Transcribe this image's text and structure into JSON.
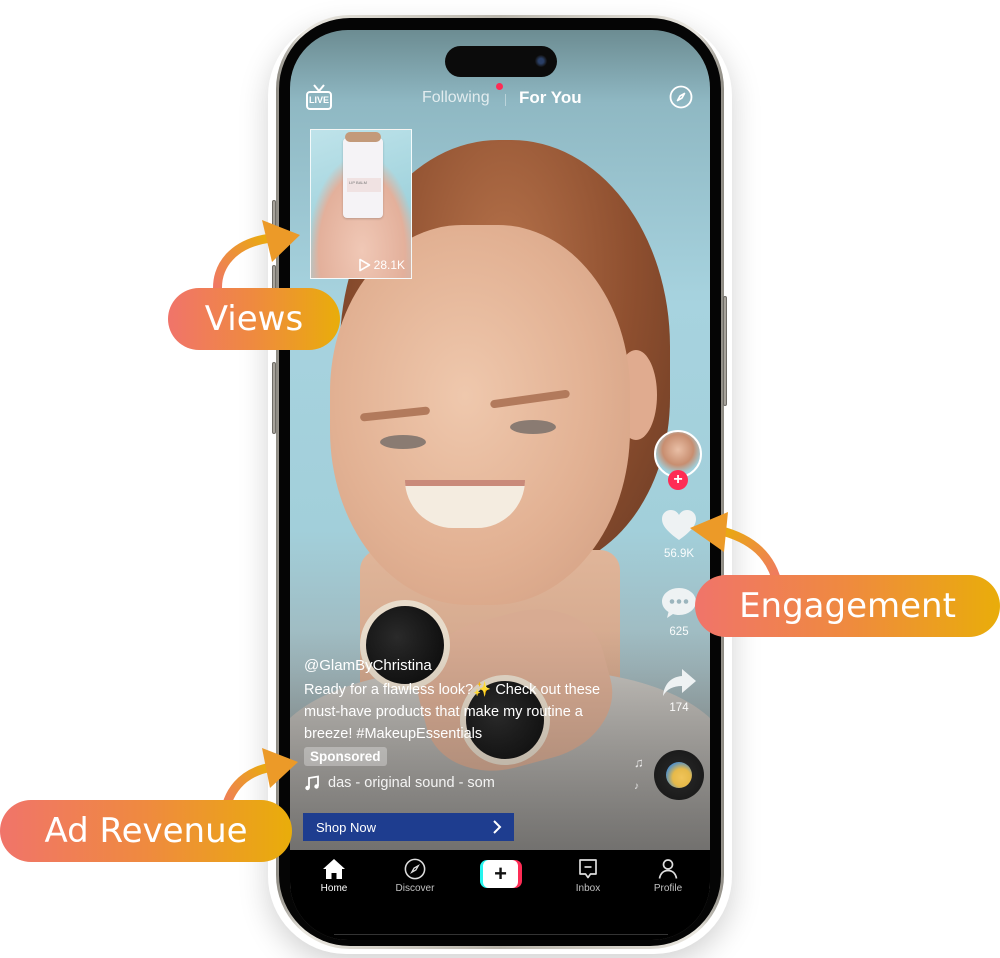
{
  "top_bar": {
    "live_label": "LIVE",
    "tabs": [
      {
        "label": "Following",
        "active": false,
        "has_notification_dot": true
      },
      {
        "label": "For You",
        "active": true
      }
    ],
    "right_icon": "compass-icon"
  },
  "thumbnail": {
    "product_label": "LIP BALM",
    "views": "28.1K",
    "views_icon": "play-icon"
  },
  "right_rail": {
    "avatar_icon": "creator-avatar",
    "follow_label": "+",
    "likes": "56.9K",
    "comments": "625",
    "shares": "174"
  },
  "caption": {
    "username": "@GlamByChristina",
    "description": "Ready for a flawless look?✨ Check out these must-have products that make my routine a breeze! #MakeupEssentials",
    "sponsored_label": "Sponsored",
    "sound": "das - original sound - som"
  },
  "cta": {
    "label": "Shop Now",
    "chevron": "›",
    "color": "#1e3d8f"
  },
  "bottom_nav": {
    "items": [
      {
        "label": "Home",
        "icon": "home-icon",
        "active": true
      },
      {
        "label": "Discover",
        "icon": "compass-icon",
        "active": false
      },
      {
        "label": "",
        "icon": "create-plus-icon",
        "active": false
      },
      {
        "label": "Inbox",
        "icon": "inbox-icon",
        "active": false
      },
      {
        "label": "Profile",
        "icon": "profile-icon",
        "active": false
      }
    ],
    "create_label": "+"
  },
  "annotations": [
    {
      "label": "Views",
      "target": "thumbnail-views"
    },
    {
      "label": "Engagement",
      "target": "likes"
    },
    {
      "label": "Ad Revenue",
      "target": "sponsored-badge"
    }
  ],
  "colors": {
    "accent_red": "#fe2c55",
    "accent_cyan": "#25f4ee",
    "pill_gradient_start": "#f0746a",
    "pill_gradient_end": "#e9ad0a"
  }
}
